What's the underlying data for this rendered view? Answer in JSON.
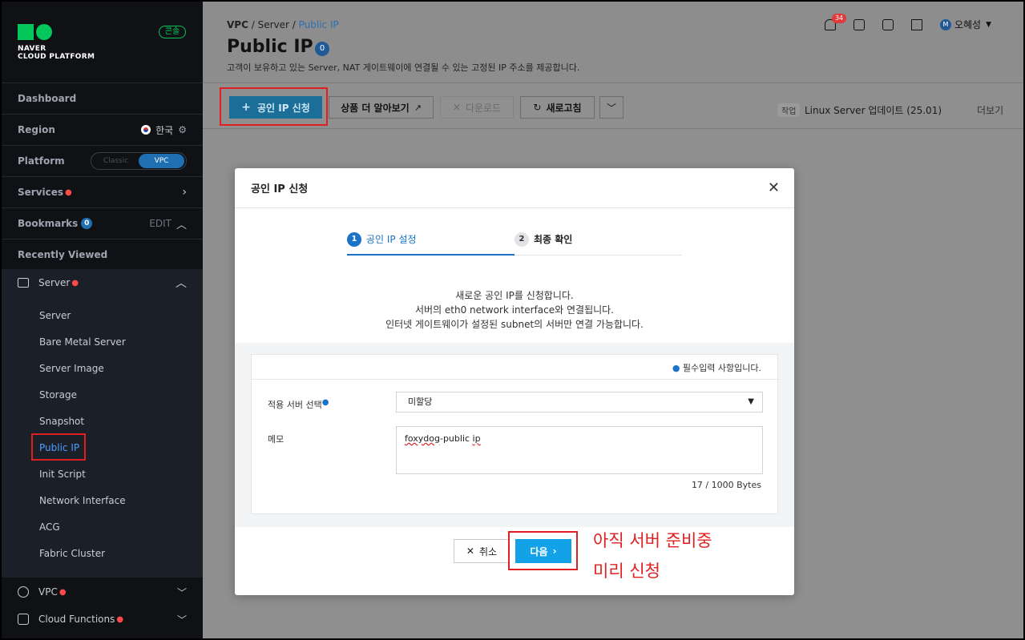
{
  "sidebar": {
    "logo_line1": "NAVER",
    "logo_line2": "CLOUD PLATFORM",
    "console_badge": "콘솔",
    "dashboard": "Dashboard",
    "region_label": "Region",
    "region_value": "한국",
    "platform_label": "Platform",
    "platform_options": [
      "Classic",
      "VPC"
    ],
    "platform_selected": "VPC",
    "services_label": "Services",
    "bookmarks_label": "Bookmarks",
    "bookmarks_count": "0",
    "bookmarks_edit": "EDIT",
    "recently_viewed": "Recently Viewed",
    "server_group": "Server",
    "server_items": [
      "Server",
      "Bare Metal Server",
      "Server Image",
      "Storage",
      "Snapshot",
      "Public IP",
      "Init Script",
      "Network Interface",
      "ACG",
      "Fabric Cluster"
    ],
    "active_item": "Public IP",
    "vpc_label": "VPC",
    "cloud_functions_label": "Cloud Functions"
  },
  "header": {
    "breadcrumb": [
      "VPC",
      "Server",
      "Public IP"
    ],
    "title": "Public IP",
    "count": "0",
    "subtitle": "고객이 보유하고 있는 Server, NAT 게이트웨이에 연결될 수 있는 고정된 IP 주소를 제공합니다.",
    "notification_count": "34",
    "user_initial": "M",
    "user_name": "오혜성"
  },
  "toolbar": {
    "create_label": "공인 IP 신청",
    "learn_more_label": "상품 더 알아보기",
    "download_label": "다운로드",
    "refresh_label": "새로고침",
    "task_tag": "작업",
    "task_text": "Linux Server 업데이트 (25.01)",
    "more_label": "더보기"
  },
  "modal": {
    "title": "공인 IP 신청",
    "step1_num": "1",
    "step1_label": "공인 IP 설정",
    "step2_num": "2",
    "step2_label": "최종 확인",
    "desc_line1": "새로운 공인 IP를 신청합니다.",
    "desc_line2": "서버의 eth0 network interface와 연결됩니다.",
    "desc_line3": "인터넷 게이트웨이가 설정된 subnet의 서버만 연결 가능합니다.",
    "required_note": "필수입력 사항입니다.",
    "server_select_label": "적용 서버 선택",
    "server_select_value": "미할당",
    "memo_label": "메모",
    "memo_value_part1": "foxydog",
    "memo_value_part2": "-public ",
    "memo_value_part3": "ip",
    "bytes_counter": "17 / 1000 Bytes",
    "cancel_label": "취소",
    "next_label": "다음"
  },
  "annotation": {
    "line1": "아직 서버 준비중",
    "line2": "미리 신청"
  },
  "colors": {
    "primary": "#13a2e8",
    "highlight": "#e02020",
    "sidebar_bg": "#0f1115"
  }
}
